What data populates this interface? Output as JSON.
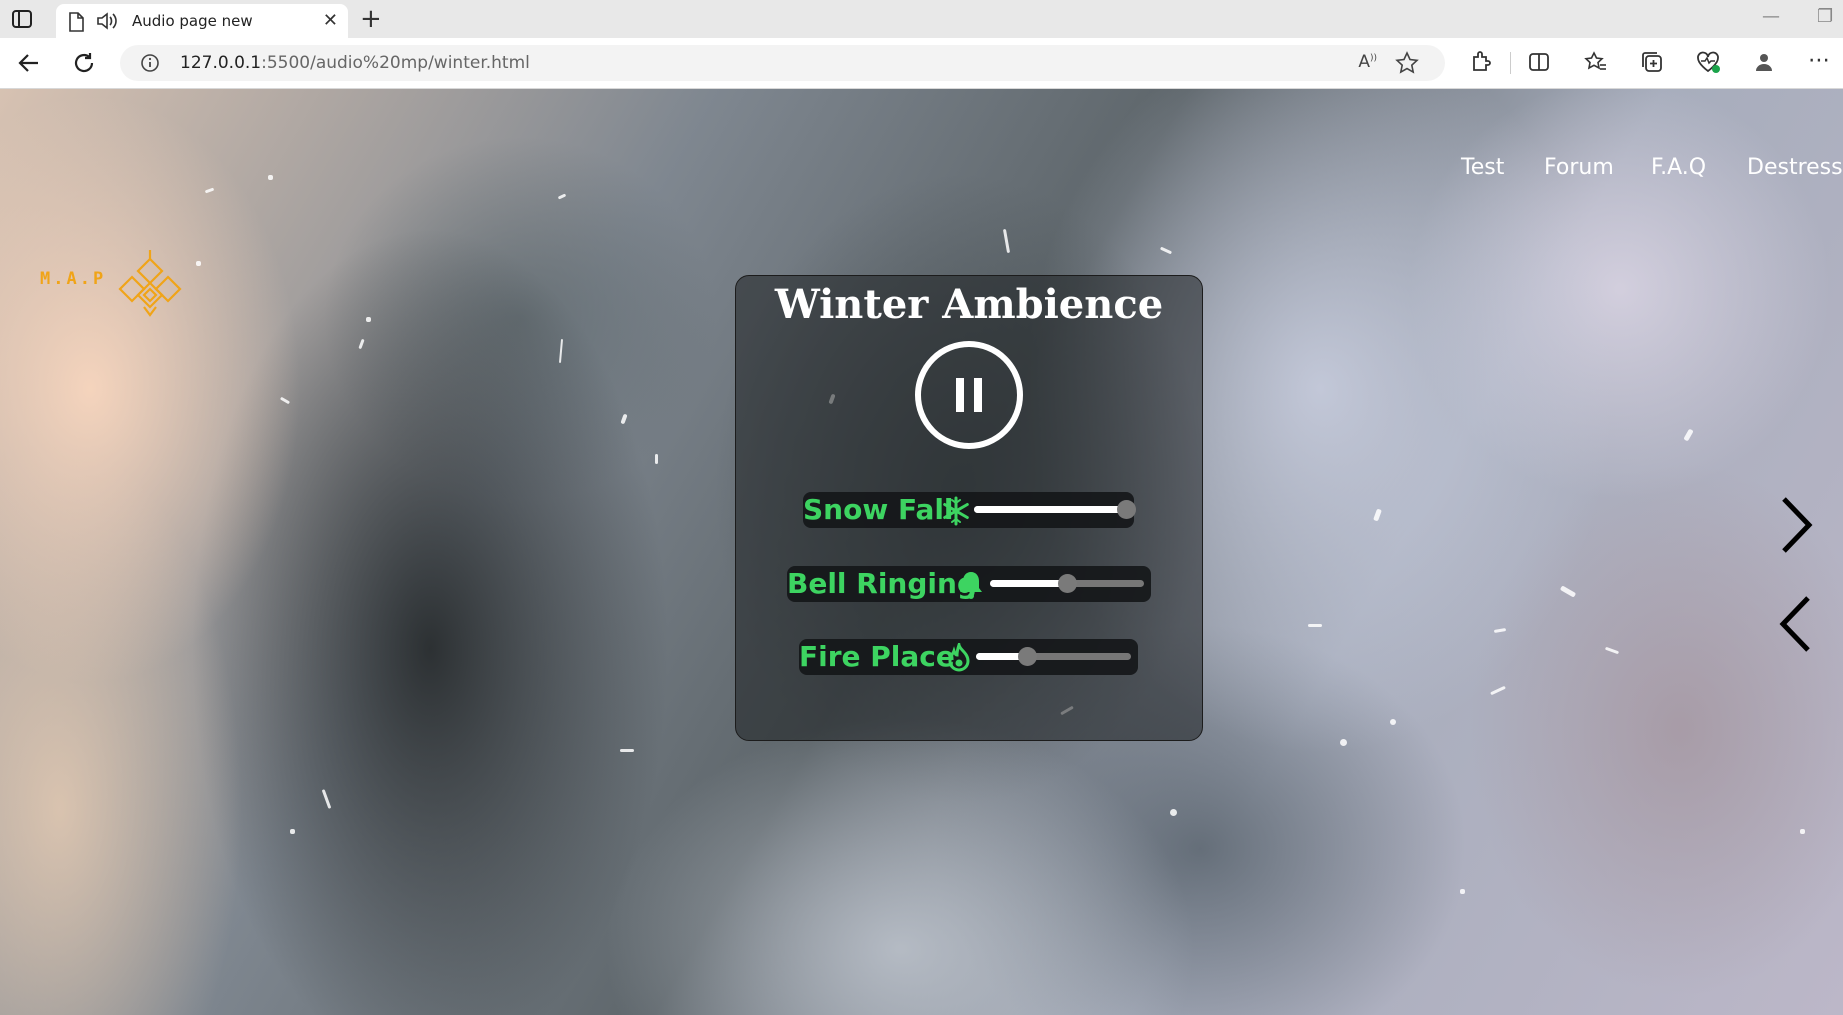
{
  "browser": {
    "tab": {
      "title": "Audio page new"
    },
    "address": {
      "url_host": "127.0.0.1",
      "url_rest": ":5500/audio%20mp/winter.html"
    }
  },
  "site": {
    "logo_text": "M.A.P",
    "logo_color": "#f0a418",
    "nav": [
      "Test",
      "Forum",
      "F.A.Q",
      "Destress"
    ]
  },
  "player": {
    "title": "Winter Ambience",
    "state": "playing",
    "label_color": "#3dd461",
    "sounds": [
      {
        "label": "Snow Fall",
        "icon": "snowflake-icon",
        "volume": 1.0
      },
      {
        "label": "Bell Ringing",
        "icon": "bell-icon",
        "volume": 0.5
      },
      {
        "label": "Fire Place",
        "icon": "flame-icon",
        "volume": 0.33
      }
    ]
  }
}
